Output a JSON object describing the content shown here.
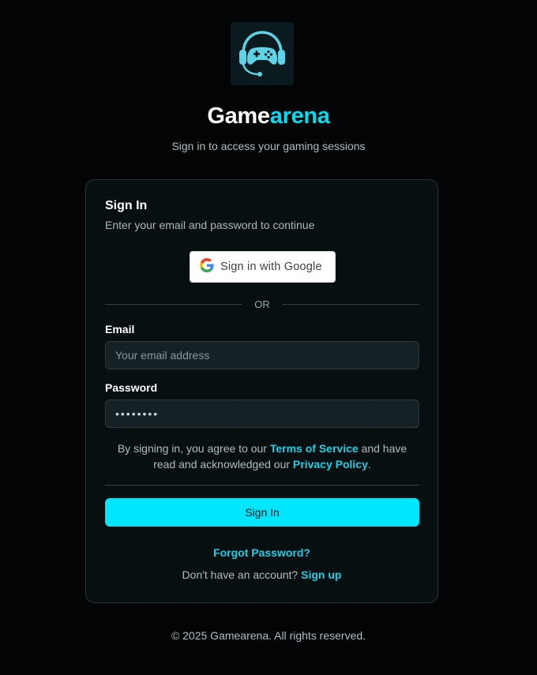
{
  "brand": {
    "name_part1": "Game",
    "name_part2": "arena",
    "tagline": "Sign in to access your gaming sessions",
    "logo_icon": "gamepad-headset-icon",
    "accent_color": "#00dcf2"
  },
  "card": {
    "title": "Sign In",
    "subtitle": "Enter your email and password to continue",
    "google_button_label": "Sign in with Google",
    "divider_text": "OR",
    "email": {
      "label": "Email",
      "placeholder": "Your email address",
      "value": ""
    },
    "password": {
      "label": "Password",
      "value": "••••••••"
    },
    "terms": {
      "prefix": "By signing in, you agree to our ",
      "tos_link": "Terms of Service",
      "middle": " and have read and acknowledged our ",
      "privacy_link": "Privacy Policy",
      "suffix": "."
    },
    "submit_label": "Sign In",
    "forgot_password": "Forgot Password?",
    "no_account_text": "Don't have an account? ",
    "signup_link": "Sign up"
  },
  "footer": {
    "copyright": "© 2025 Gamearena. All rights reserved."
  }
}
